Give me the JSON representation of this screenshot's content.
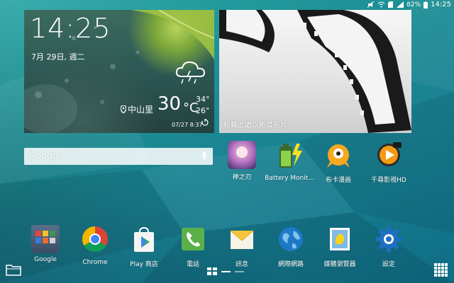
{
  "status_bar": {
    "battery_pct": "82%",
    "time": "14:25"
  },
  "clock_widget": {
    "time": "14:25",
    "date": "7月 29日, 週二",
    "location": "中山里",
    "temperature": "30",
    "temp_unit": "°C",
    "high": "34°",
    "low": "26°",
    "updated": "07/27 8:37"
  },
  "video_widget": {
    "hint": "輕觸此處以新增影片。"
  },
  "search_bar": {
    "label": "Google"
  },
  "apps_row1": [
    {
      "label": "神之刃"
    },
    {
      "label": "Battery Monit..."
    },
    {
      "label": "布卡漫画"
    },
    {
      "label": "千尋影視HD"
    }
  ],
  "dock": [
    {
      "label": "Google"
    },
    {
      "label": "Chrome"
    },
    {
      "label": "Play 商店"
    },
    {
      "label": "電話"
    },
    {
      "label": "訊息"
    },
    {
      "label": "網際網路"
    },
    {
      "label": "媒體瀏覽器"
    },
    {
      "label": "設定"
    }
  ]
}
